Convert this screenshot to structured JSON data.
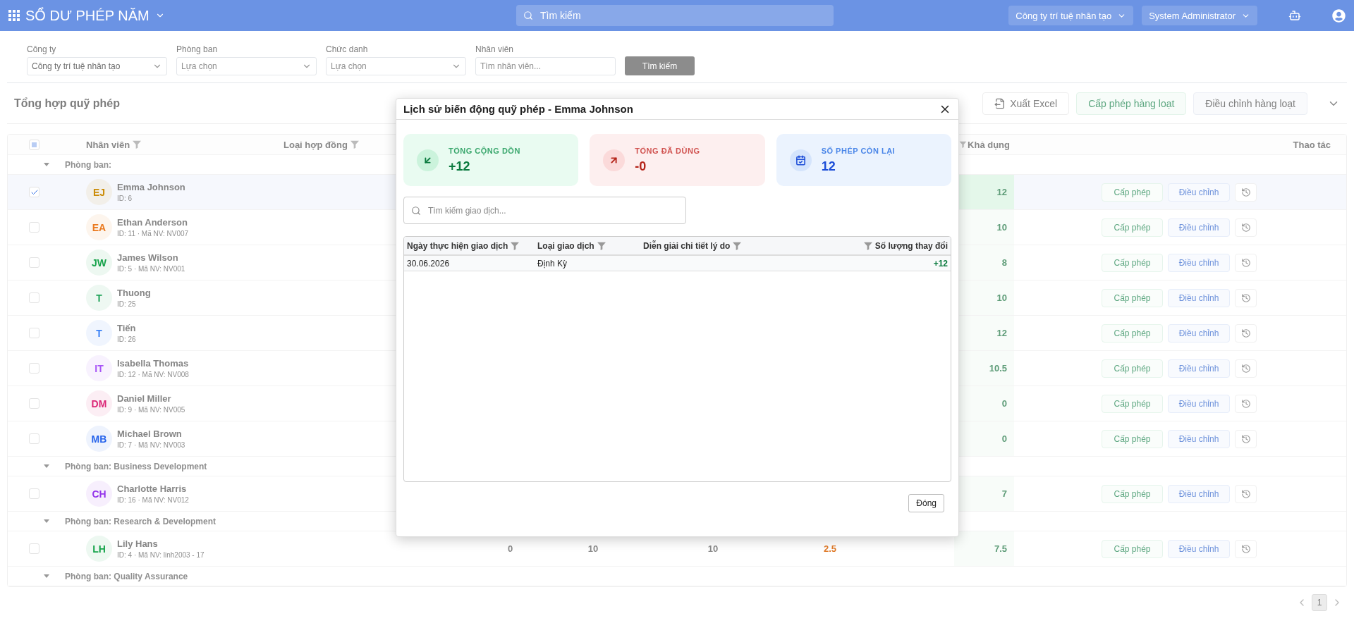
{
  "app_bar": {
    "title": "SỔ DƯ PHÉP NĂM",
    "search": {
      "placeholder": "Tìm kiếm"
    },
    "company": "Công ty trí tuệ nhân tạo",
    "user": "System Administrator"
  },
  "filters": [
    {
      "kind": "select",
      "label": "Công ty",
      "value": "Công ty trí tuệ nhân tạo"
    },
    {
      "kind": "select",
      "label": "Phòng ban",
      "placeholder": "Lựa chọn"
    },
    {
      "kind": "select",
      "label": "Chức danh",
      "placeholder": "Lựa chọn"
    },
    {
      "kind": "input",
      "label": "Nhân viên",
      "placeholder": "Tìm nhân viên..."
    }
  ],
  "search_button": {
    "label": "Tìm kiếm",
    "disabled": true
  },
  "section": {
    "title": "Tổng hợp quỹ phép",
    "buttons": [
      {
        "kind": "export",
        "label": "Xuất Excel"
      },
      {
        "kind": "grant",
        "label": "Cấp phép hàng loạt"
      },
      {
        "kind": "adjust",
        "label": "Điều chỉnh hàng loạt"
      }
    ]
  },
  "table": {
    "header_checkbox": {
      "indeterminate": true
    },
    "columns": [
      "Nhân viên",
      "Loại hợp đồng",
      "Khả dụng",
      "Thao tác"
    ],
    "rows": [
      {
        "kind": "group",
        "label": "Phòng ban:",
        "expanded": true
      },
      {
        "kind": "employee",
        "initials": "EJ",
        "color": "#ca8a04",
        "name": "Emma Johnson",
        "meta": "ID: 6",
        "checked": true,
        "available": "12",
        "grant": "Cấp phép",
        "adjust": "Điều chỉnh"
      },
      {
        "kind": "employee",
        "initials": "EA",
        "color": "#ea7a1f",
        "name": "Ethan Anderson",
        "meta": "ID: 11 · Mã NV: NV007",
        "checked": false,
        "available": "10",
        "grant": "Cấp phép",
        "adjust": "Điều chỉnh"
      },
      {
        "kind": "employee",
        "initials": "JW",
        "color": "#16a34a",
        "name": "James Wilson",
        "meta": "ID: 5 · Mã NV: NV001",
        "checked": false,
        "available": "8",
        "grant": "Cấp phép",
        "adjust": "Điều chỉnh"
      },
      {
        "kind": "employee",
        "initials": "T",
        "color": "#22a35a",
        "name": "Thuong",
        "meta": "ID: 25",
        "checked": false,
        "available": "10",
        "grant": "Cấp phép",
        "adjust": "Điều chỉnh"
      },
      {
        "kind": "employee",
        "initials": "T",
        "color": "#3b82f6",
        "name": "Tiến",
        "meta": "ID: 26",
        "checked": false,
        "available": "12",
        "grant": "Cấp phép",
        "adjust": "Điều chỉnh"
      },
      {
        "kind": "employee",
        "initials": "IT",
        "color": "#a855f7",
        "name": "Isabella Thomas",
        "meta": "ID: 12 · Mã NV: NV008",
        "checked": false,
        "available": "10.5",
        "grant": "Cấp phép",
        "adjust": "Điều chỉnh"
      },
      {
        "kind": "employee",
        "initials": "DM",
        "color": "#db2777",
        "name": "Daniel Miller",
        "meta": "ID: 9 · Mã NV: NV005",
        "checked": false,
        "available": "0",
        "grant": "Cấp phép",
        "adjust": "Điều chỉnh"
      },
      {
        "kind": "employee",
        "initials": "MB",
        "color": "#2563eb",
        "name": "Michael Brown",
        "meta": "ID: 7 · Mã NV: NV003",
        "checked": false,
        "available": "0",
        "grant": "Cấp phép",
        "adjust": "Điều chỉnh"
      },
      {
        "kind": "group",
        "label": "Phòng ban: Business Development",
        "expanded": true
      },
      {
        "kind": "employee",
        "initials": "CH",
        "color": "#9333ea",
        "name": "Charlotte Harris",
        "meta": "ID: 16 · Mã NV: NV012",
        "checked": false,
        "available": "7",
        "grant": "Cấp phép",
        "adjust": "Điều chỉnh"
      },
      {
        "kind": "group",
        "label": "Phòng ban: Research & Development",
        "expanded": true
      },
      {
        "kind": "employee",
        "initials": "LH",
        "color": "#15a34a",
        "name": "Lily Hans",
        "meta": "ID: 4 · Mã NV: linh2003 - 17",
        "checked": false,
        "column_3": "0",
        "column_4": "10",
        "column_5": "10",
        "column_6": "2.5",
        "available": "7.5",
        "grant": "Cấp phép",
        "adjust": "Điều chỉnh"
      },
      {
        "kind": "group",
        "label": "Phòng ban: Quality Assurance",
        "expanded": true
      }
    ]
  },
  "pagination": {
    "pages": [
      {
        "label": "1",
        "selected": true
      }
    ]
  },
  "dialog": {
    "title": "Lịch sử biến động quỹ phép - Emma Johnson",
    "stats": [
      {
        "kind": "accrued",
        "label": "TỔNG CỘNG DỒN",
        "value": "+12"
      },
      {
        "kind": "used",
        "label": "TỔNG ĐÃ DÙNG",
        "value": "-0"
      },
      {
        "kind": "remaining",
        "label": "SỐ PHÉP CÒN LẠI",
        "value": "12"
      }
    ],
    "search": {
      "placeholder": "Tìm kiếm giao dịch..."
    },
    "columns": [
      "Ngày thực hiện giao dịch",
      "Loại giao dịch",
      "Diễn giải chi tiết lý do",
      "Số lượng thay đổi"
    ],
    "rows": [
      {
        "date": "30.06.2026",
        "type": "Định Kỳ",
        "change": "+12"
      }
    ],
    "close_button": "Đóng"
  }
}
